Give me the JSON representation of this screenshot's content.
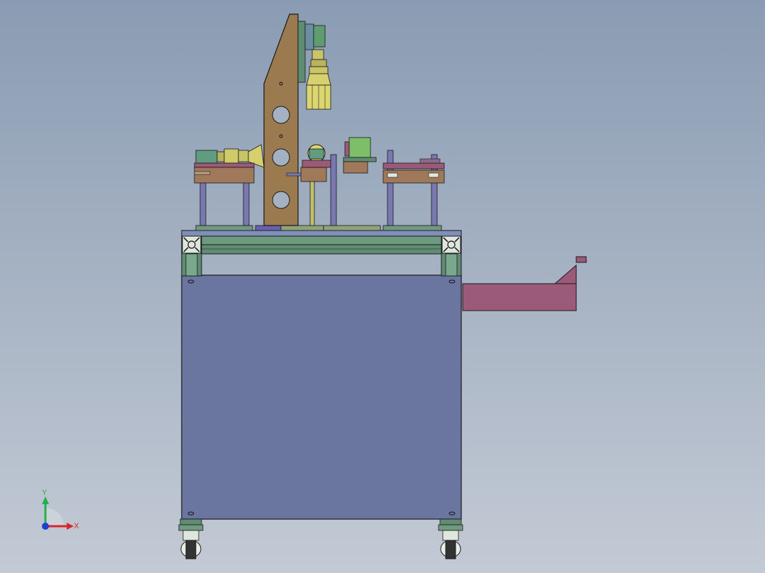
{
  "viewport": {
    "background_top": "#8a9cb3",
    "background_bottom": "#c3cad5"
  },
  "triad": {
    "y_label": "Y",
    "x_label": "X",
    "y_color": "#22b14c",
    "x_color": "#d9262a",
    "z_color": "#2040d0"
  },
  "model": {
    "cabinet_color": "#6b76a0",
    "frame_color": "#5f8c72",
    "plate_color": "#9a7a4e",
    "chute_color": "#9a5a78",
    "post_color": "#7a78b0",
    "brass_color": "#c9c46a"
  }
}
